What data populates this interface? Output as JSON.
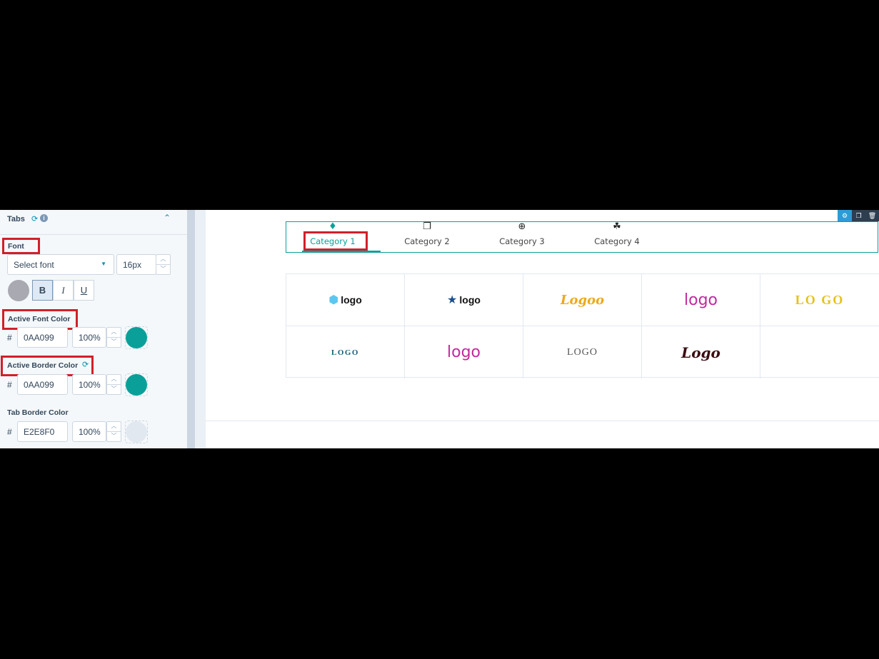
{
  "panel": {
    "section_title": "Tabs",
    "font": {
      "label": "Font",
      "select_placeholder": "Select font",
      "size_value": "16px",
      "bold": "B",
      "italic": "I",
      "underline": "U"
    },
    "active_font_color": {
      "label": "Active Font Color",
      "hex": "0AA099",
      "opacity": "100%",
      "swatch": "#0aa099"
    },
    "active_border_color": {
      "label": "Active Border Color",
      "hex": "0AA099",
      "opacity": "100%",
      "swatch": "#0aa099"
    },
    "tab_border_color": {
      "label": "Tab Border Color",
      "hex": "E2E8F0",
      "opacity": "100%",
      "swatch": "#e2e8f0"
    },
    "hash_symbol": "#"
  },
  "tabs": [
    {
      "label": "Category 1",
      "icon": "diamond-icon",
      "glyph": "♦",
      "active": true
    },
    {
      "label": "Category 2",
      "icon": "copy-icon",
      "glyph": "❐",
      "active": false
    },
    {
      "label": "Category 3",
      "icon": "upload-circle-icon",
      "glyph": "⊕",
      "active": false
    },
    {
      "label": "Category 4",
      "icon": "boxes-icon",
      "glyph": "☘",
      "active": false
    }
  ],
  "logos": [
    {
      "text": "logo",
      "color": "#111111",
      "mark": "⬢",
      "mark_color": "#5bc7f0"
    },
    {
      "text": "logo",
      "color": "#111111",
      "mark": "★",
      "mark_color": "#1b4f8a"
    },
    {
      "text": "Logoo",
      "color": "#f0a81b",
      "mark": "",
      "mark_color": ""
    },
    {
      "text": "logo",
      "color": "#c2299f",
      "mark": "",
      "mark_color": ""
    },
    {
      "text": "LO GO",
      "color": "#e6c21a",
      "mark": "",
      "mark_color": ""
    },
    {
      "text": "LOGO",
      "color": "#14607a",
      "mark": "",
      "mark_color": ""
    },
    {
      "text": "logo",
      "color": "#c2299f",
      "mark": "",
      "mark_color": ""
    },
    {
      "text": "LOGO",
      "color": "#555555",
      "mark": "",
      "mark_color": ""
    },
    {
      "text": "Logo",
      "color": "#3a0d12",
      "mark": "",
      "mark_color": ""
    },
    {
      "text": "",
      "color": "",
      "mark": "",
      "mark_color": ""
    }
  ],
  "colors": {
    "accent": "#0aa099",
    "highlight_red": "#d0202a"
  }
}
